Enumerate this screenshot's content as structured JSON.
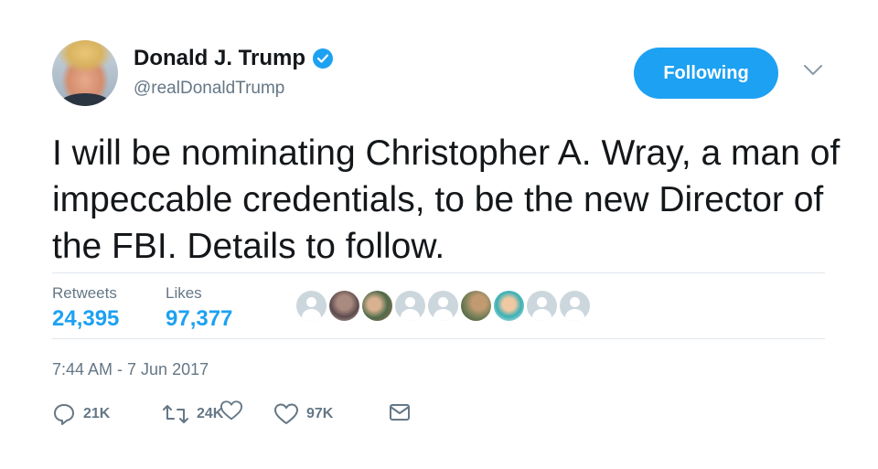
{
  "author": {
    "display_name": "Donald J. Trump",
    "handle": "@realDonaldTrump",
    "verified": true
  },
  "follow_button": {
    "label": "Following",
    "color": "#1da1f2"
  },
  "tweet": {
    "text": "I will be nominating Christopher A. Wray, a man of impeccable credentials, to be the new Director of the FBI. Details to follow."
  },
  "stats": {
    "retweets": {
      "label": "Retweets",
      "value": "24,395"
    },
    "likes": {
      "label": "Likes",
      "value": "97,377"
    }
  },
  "timestamp": "7:44 AM - 7 Jun 2017",
  "actions": {
    "reply": {
      "icon": "reply-icon",
      "count": "21K"
    },
    "retweet": {
      "icon": "retweet-icon",
      "count": "24K"
    },
    "like": {
      "icon": "heart-icon",
      "count": "97K"
    },
    "message": {
      "icon": "envelope-icon"
    }
  },
  "colors": {
    "accent": "#1da1f2",
    "secondary_text": "#657786",
    "primary_text": "#14171a",
    "divider": "#e1e8ed"
  }
}
